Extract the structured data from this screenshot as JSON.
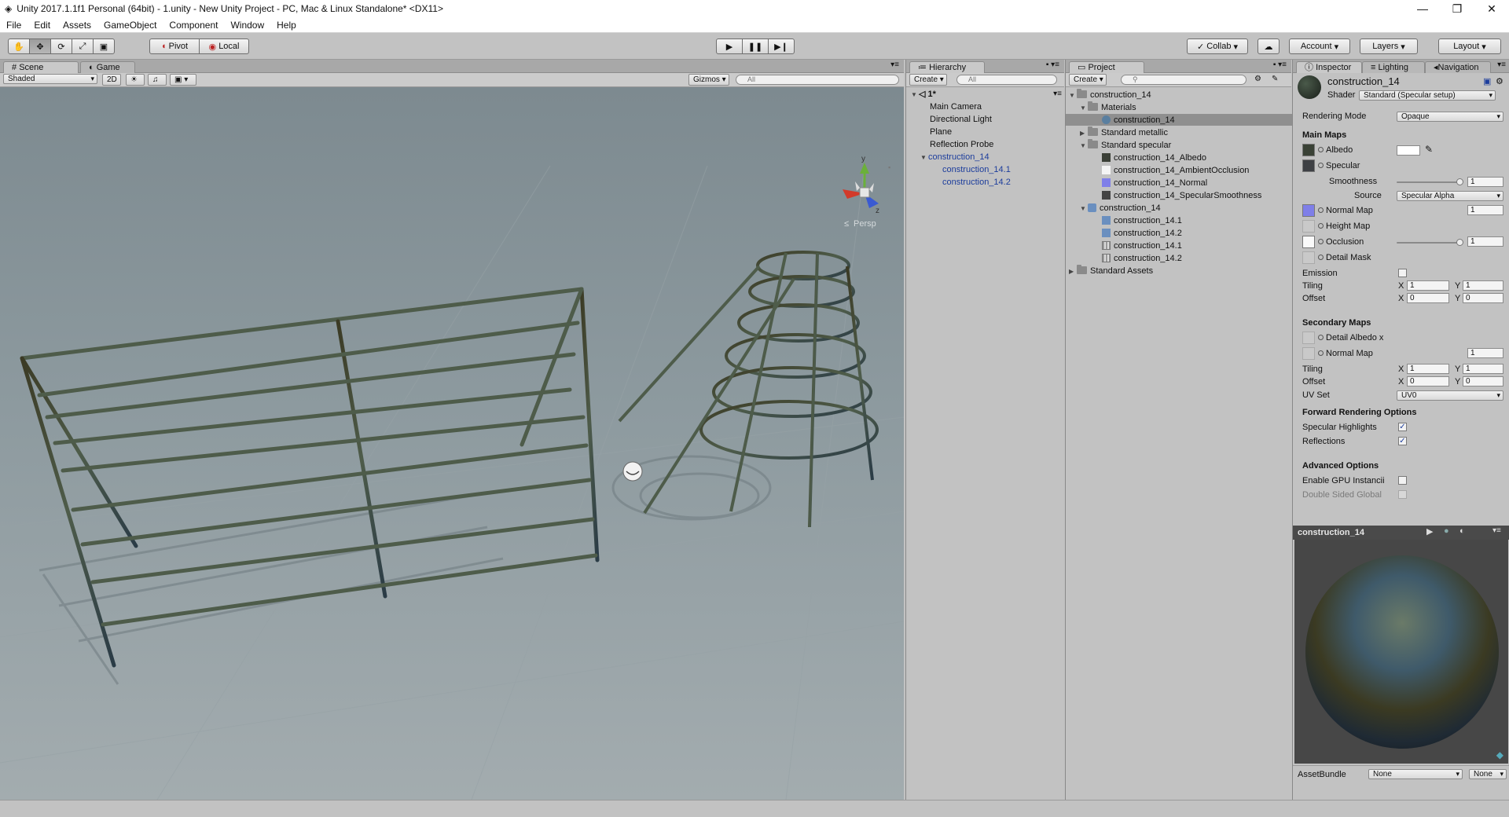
{
  "window": {
    "title": "Unity 2017.1.1f1 Personal (64bit) - 1.unity - New Unity Project - PC, Mac & Linux Standalone* <DX11>",
    "minimize": "—",
    "maximize": "❐",
    "close": "✕"
  },
  "menu": [
    "File",
    "Edit",
    "Assets",
    "GameObject",
    "Component",
    "Window",
    "Help"
  ],
  "toolbar": {
    "pivot": "Pivot",
    "local": "Local",
    "collab": "Collab",
    "account": "Account",
    "layers": "Layers",
    "layout": "Layout"
  },
  "scene": {
    "tabs": [
      "Scene",
      "Game"
    ],
    "shading": "Shaded",
    "mode2d": "2D",
    "gizmos": "Gizmos",
    "search_placeholder": "All",
    "persp": "Persp",
    "axis_y": "y",
    "axis_z": "z"
  },
  "hierarchy": {
    "tab": "Hierarchy",
    "create": "Create",
    "search_placeholder": "All",
    "scene_name": "1*",
    "items": [
      "Main Camera",
      "Directional Light",
      "Plane",
      "Reflection Probe",
      "construction_14",
      "construction_14.1",
      "construction_14.2"
    ]
  },
  "project": {
    "tab": "Project",
    "create": "Create",
    "tree": [
      "construction_14",
      "Materials",
      "construction_14",
      "Standard metallic",
      "Standard specular",
      "construction_14_Albedo",
      "construction_14_AmbientOcclusion",
      "construction_14_Normal",
      "construction_14_SpecularSmoothness",
      "construction_14",
      "construction_14.1",
      "construction_14.2",
      "construction_14.1",
      "construction_14.2",
      "Standard Assets"
    ]
  },
  "inspector": {
    "tabs": [
      "Inspector",
      "Lighting",
      "Navigation"
    ],
    "object_name": "construction_14",
    "shader_label": "Shader",
    "shader_value": "Standard (Specular setup)",
    "rendering_mode_label": "Rendering Mode",
    "rendering_mode_value": "Opaque",
    "main_maps": "Main Maps",
    "albedo": "Albedo",
    "specular": "Specular",
    "smoothness": "Smoothness",
    "smoothness_value": "1",
    "source": "Source",
    "source_value": "Specular Alpha",
    "normal_map": "Normal Map",
    "normal_value": "1",
    "height_map": "Height Map",
    "occlusion": "Occlusion",
    "occlusion_value": "1",
    "detail_mask": "Detail Mask",
    "emission": "Emission",
    "tiling": "Tiling",
    "offset": "Offset",
    "x": "X",
    "y": "Y",
    "tiling_x": "1",
    "tiling_y": "1",
    "offset_x": "0",
    "offset_y": "0",
    "secondary_maps": "Secondary Maps",
    "detail_albedo": "Detail Albedo x",
    "normal_map2": "Normal Map",
    "normal_value2": "1",
    "tiling2_x": "1",
    "tiling2_y": "1",
    "offset2_x": "0",
    "offset2_y": "0",
    "uv_set": "UV Set",
    "uv_set_value": "UV0",
    "forward_options": "Forward Rendering Options",
    "specular_highlights": "Specular Highlights",
    "reflections": "Reflections",
    "advanced": "Advanced Options",
    "gpu_instancing": "Enable GPU Instancii",
    "double_sided": "Double Sided Global",
    "preview_title": "construction_14",
    "asset_bundle": "AssetBundle",
    "bundle_none": "None",
    "bundle_none2": "None"
  },
  "colors": {
    "accent_blue": "#1c3d9c",
    "selection": "#8f8f8f",
    "panel": "#c2c2c2"
  }
}
